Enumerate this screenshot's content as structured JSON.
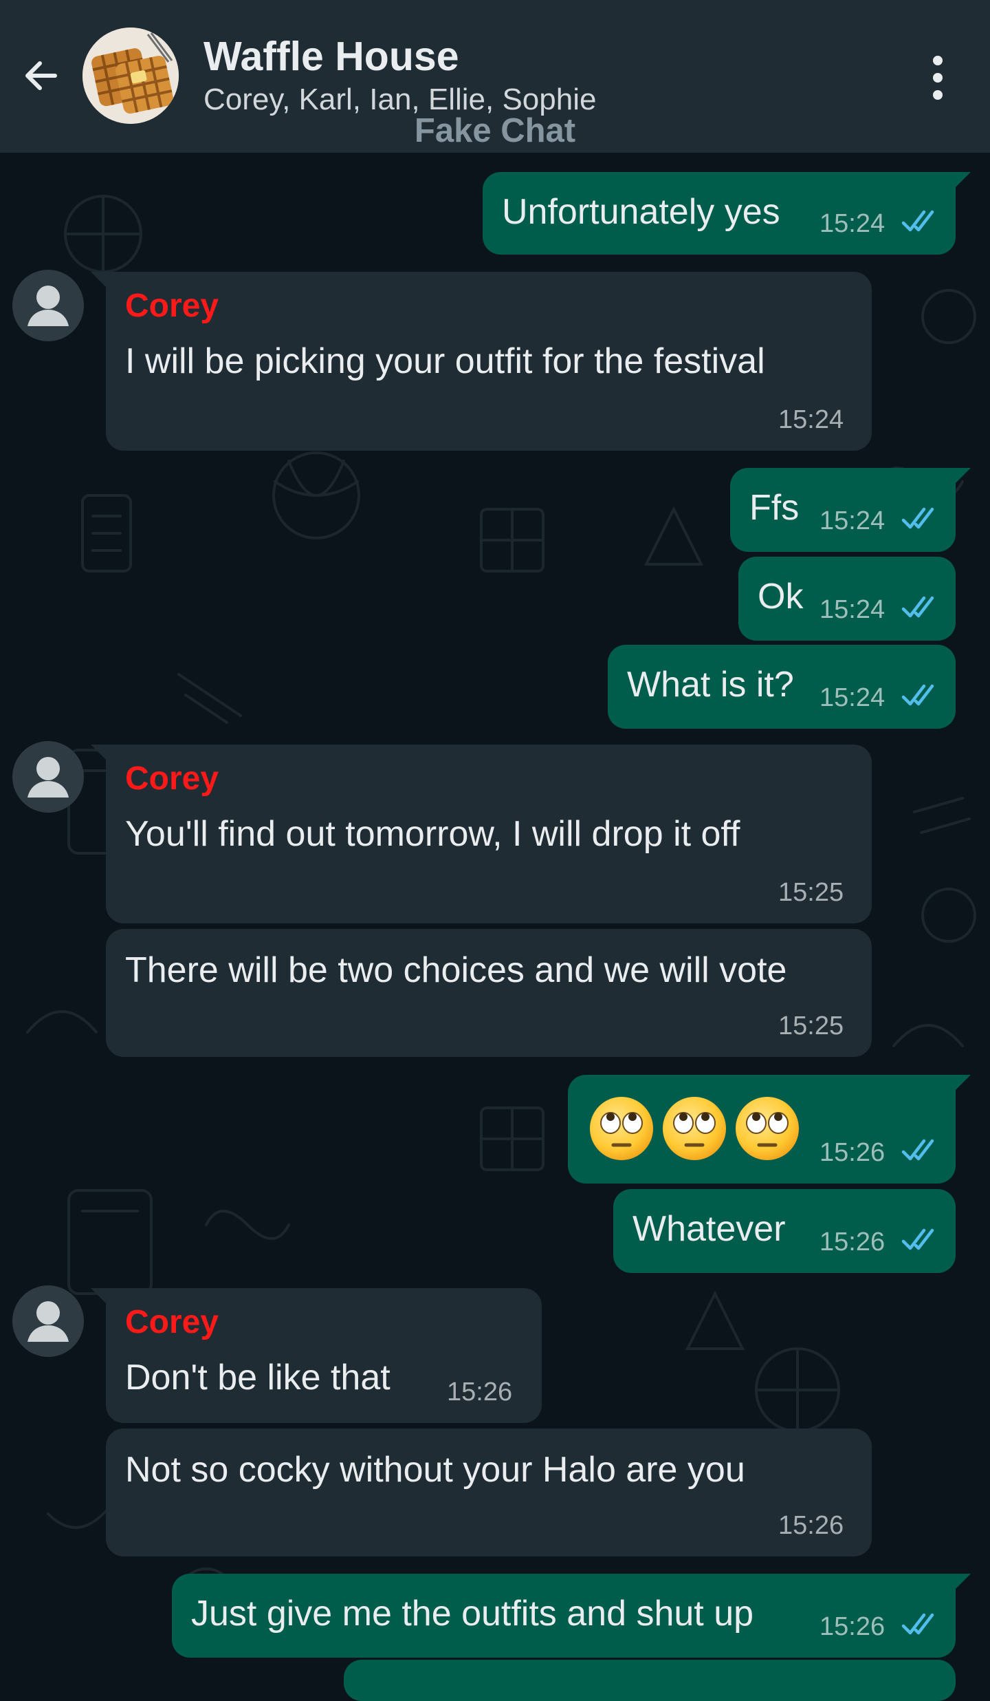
{
  "header": {
    "back_icon": "arrow-left-icon",
    "group_name": "Waffle House",
    "members": "Corey, Karl, Ian, Ellie, Sophie",
    "watermark": "Fake Chat",
    "menu_icon": "more-vert-icon"
  },
  "colors": {
    "header_bg": "#202c33",
    "chat_bg": "#0b141a",
    "outgoing_bubble": "#005c4b",
    "incoming_bubble": "#202c33",
    "sender_name": "#ff1a1a",
    "read_ticks": "#53bdeb"
  },
  "messages": [
    {
      "dir": "out",
      "text": "Unfortunately yes",
      "time": "15:24",
      "status": "read"
    },
    {
      "dir": "in",
      "sender": "Corey",
      "text": "I will be picking your outfit for the festival",
      "time": "15:24"
    },
    {
      "dir": "out",
      "text": "Ffs",
      "time": "15:24",
      "status": "read"
    },
    {
      "dir": "out",
      "text": "Ok",
      "time": "15:24",
      "status": "read"
    },
    {
      "dir": "out",
      "text": "What is it?",
      "time": "15:24",
      "status": "read"
    },
    {
      "dir": "in",
      "sender": "Corey",
      "text": "You'll find out tomorrow, I will drop it off",
      "time": "15:25"
    },
    {
      "dir": "in",
      "text": "There will be two choices and we will vote",
      "time": "15:25"
    },
    {
      "dir": "out",
      "emoji": [
        "face-with-rolling-eyes",
        "face-with-rolling-eyes",
        "face-with-rolling-eyes"
      ],
      "time": "15:26",
      "status": "read"
    },
    {
      "dir": "out",
      "text": "Whatever",
      "time": "15:26",
      "status": "read"
    },
    {
      "dir": "in",
      "sender": "Corey",
      "text": "Don't be like that",
      "time": "15:26"
    },
    {
      "dir": "in",
      "text": "Not so cocky without your Halo are you",
      "time": "15:26"
    },
    {
      "dir": "out",
      "text": "Just give me the outfits and shut up",
      "time": "15:26",
      "status": "read"
    }
  ]
}
